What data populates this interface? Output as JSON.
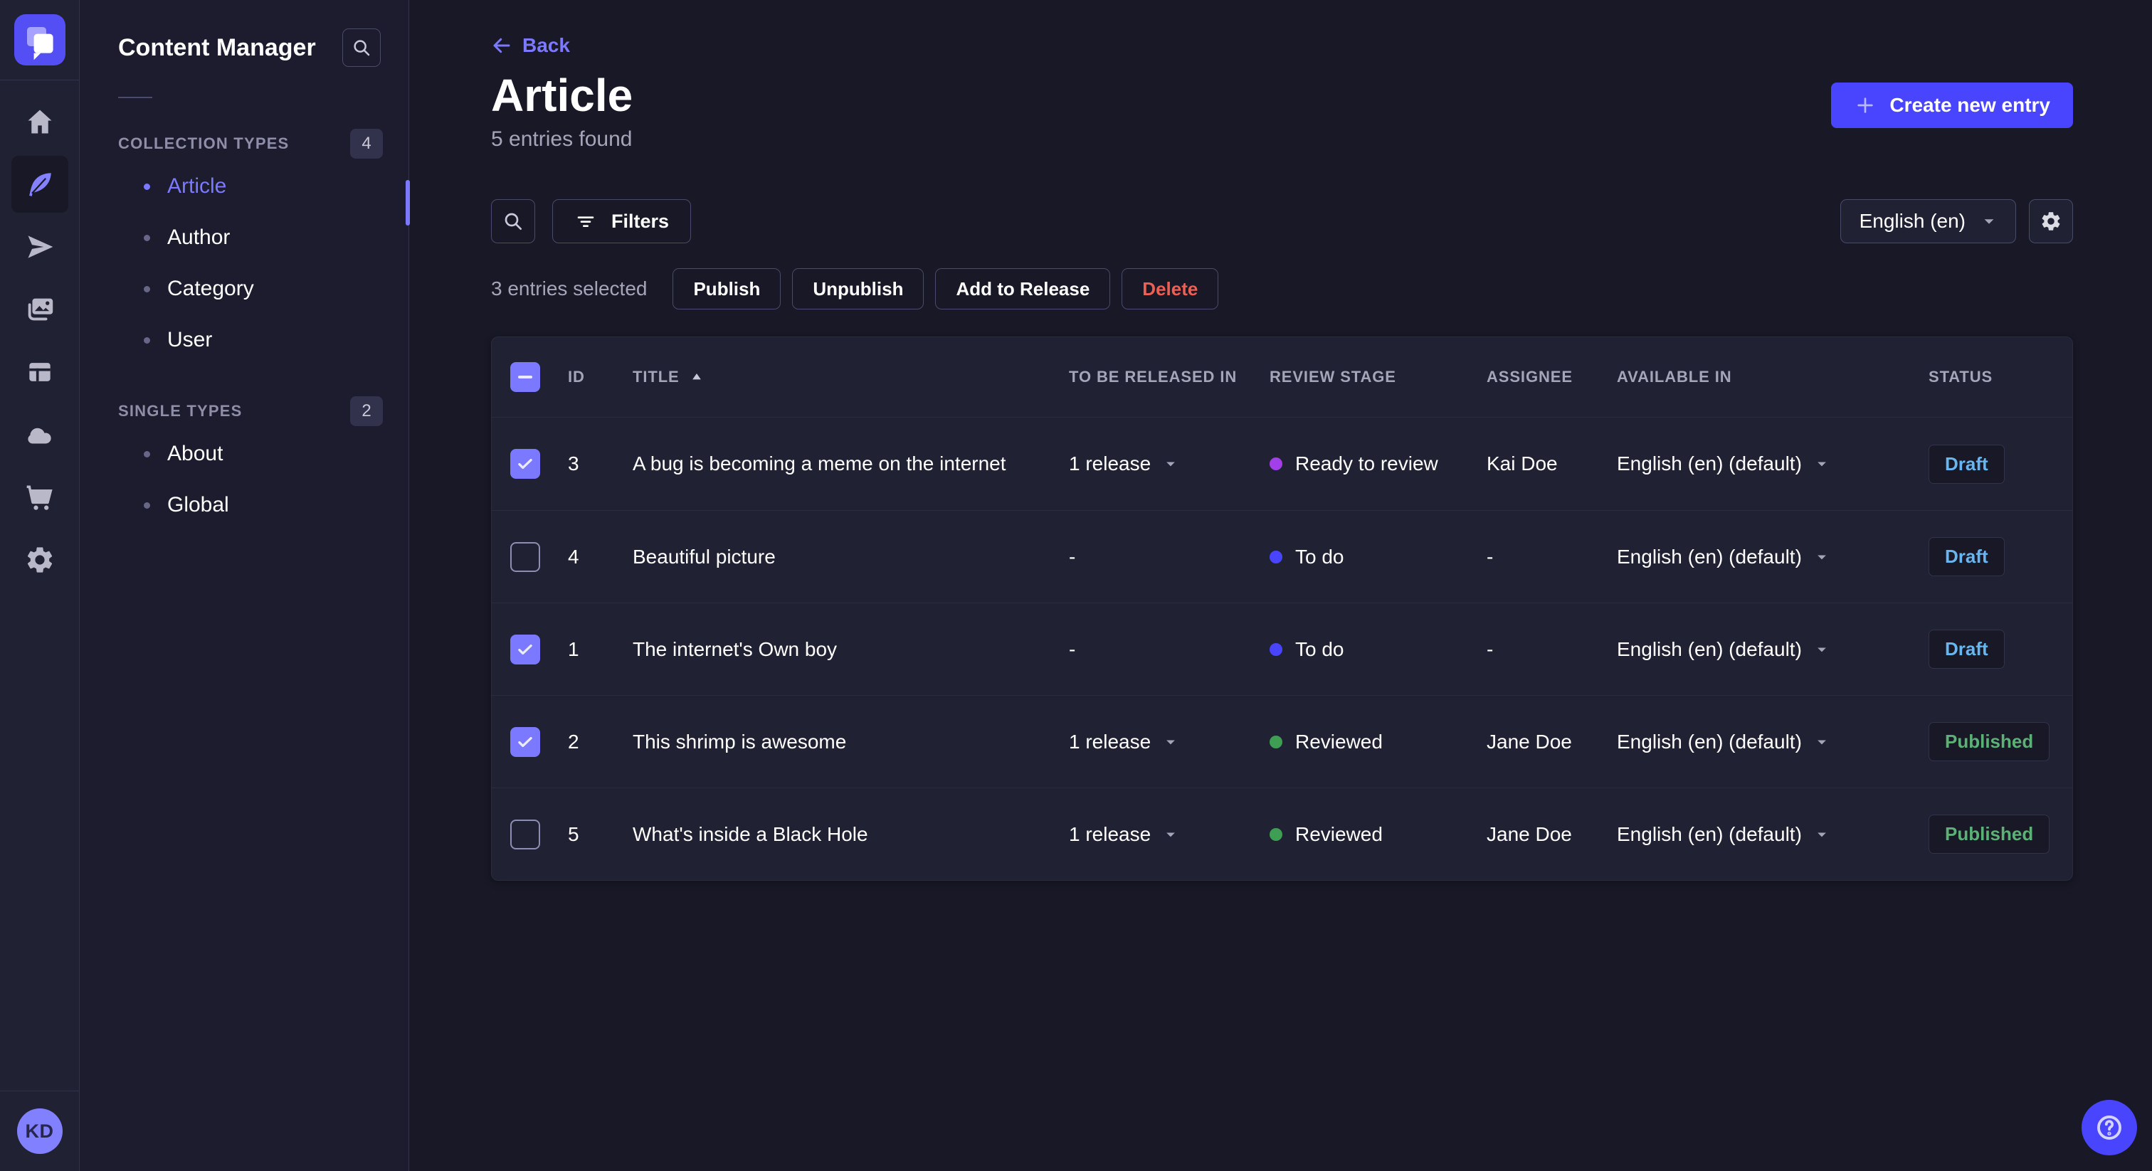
{
  "colors": {
    "primary": "#4945ff",
    "primary-light": "#7b79ff",
    "rail-bg": "#212134",
    "sidebar-bg": "#1c1c2e",
    "main-bg": "#181826",
    "card-bg": "#212134",
    "border": "#32324d",
    "border-strong": "#4a4a6a",
    "danger": "#ee5e52",
    "draft": "#66b7f1",
    "published": "#5cb176"
  },
  "nav_rail": {
    "avatar_initials": "KD"
  },
  "sidebar": {
    "title": "Content Manager",
    "sections": [
      {
        "label": "COLLECTION TYPES",
        "count": "4",
        "items": [
          {
            "label": "Article"
          },
          {
            "label": "Author"
          },
          {
            "label": "Category"
          },
          {
            "label": "User"
          }
        ]
      },
      {
        "label": "SINGLE TYPES",
        "count": "2",
        "items": [
          {
            "label": "About"
          },
          {
            "label": "Global"
          }
        ]
      }
    ]
  },
  "header": {
    "back_label": "Back",
    "title": "Article",
    "subtitle": "5 entries found",
    "create_label": "Create new entry"
  },
  "toolbar": {
    "filters_label": "Filters",
    "locale_value": "English (en)"
  },
  "selection": {
    "summary": "3 entries selected",
    "publish_label": "Publish",
    "unpublish_label": "Unpublish",
    "add_to_release_label": "Add to Release",
    "delete_label": "Delete"
  },
  "table": {
    "columns": {
      "id": "ID",
      "title": "TITLE",
      "release": "TO BE RELEASED IN",
      "stage": "REVIEW STAGE",
      "assignee": "ASSIGNEE",
      "available": "AVAILABLE IN",
      "status": "STATUS"
    },
    "rows": [
      {
        "checked": true,
        "id": "3",
        "title": "A bug is becoming a meme on the internet",
        "release": "1 release",
        "release_menu": true,
        "stage": "Ready to review",
        "stage_color": "#a13fe8",
        "assignee": "Kai Doe",
        "available": "English (en) (default)",
        "status": "Draft",
        "status_type": "draft"
      },
      {
        "checked": false,
        "id": "4",
        "title": "Beautiful picture",
        "release": "-",
        "release_menu": false,
        "stage": "To do",
        "stage_color": "#4945ff",
        "assignee": "-",
        "available": "English (en) (default)",
        "status": "Draft",
        "status_type": "draft"
      },
      {
        "checked": true,
        "id": "1",
        "title": "The internet's Own boy",
        "release": "-",
        "release_menu": false,
        "stage": "To do",
        "stage_color": "#4945ff",
        "assignee": "-",
        "available": "English (en) (default)",
        "status": "Draft",
        "status_type": "draft"
      },
      {
        "checked": true,
        "id": "2",
        "title": "This shrimp is awesome",
        "release": "1 release",
        "release_menu": true,
        "stage": "Reviewed",
        "stage_color": "#3e9e54",
        "assignee": "Jane Doe",
        "available": "English (en) (default)",
        "status": "Published",
        "status_type": "published"
      },
      {
        "checked": false,
        "id": "5",
        "title": "What's inside a Black Hole",
        "release": "1 release",
        "release_menu": true,
        "stage": "Reviewed",
        "stage_color": "#3e9e54",
        "assignee": "Jane Doe",
        "available": "English (en) (default)",
        "status": "Published",
        "status_type": "published"
      }
    ]
  }
}
